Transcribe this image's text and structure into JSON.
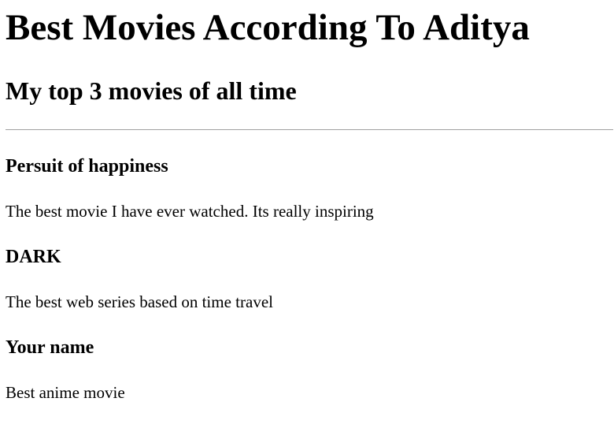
{
  "page": {
    "title": "Best Movies According To Aditya",
    "subtitle": "My top 3 movies of all time"
  },
  "movies": [
    {
      "title": "Persuit of happiness",
      "description": "The best movie I have ever watched. Its really inspiring"
    },
    {
      "title": "DARK",
      "description": "The best web series based on time travel"
    },
    {
      "title": "Your name",
      "description": "Best anime movie"
    }
  ]
}
